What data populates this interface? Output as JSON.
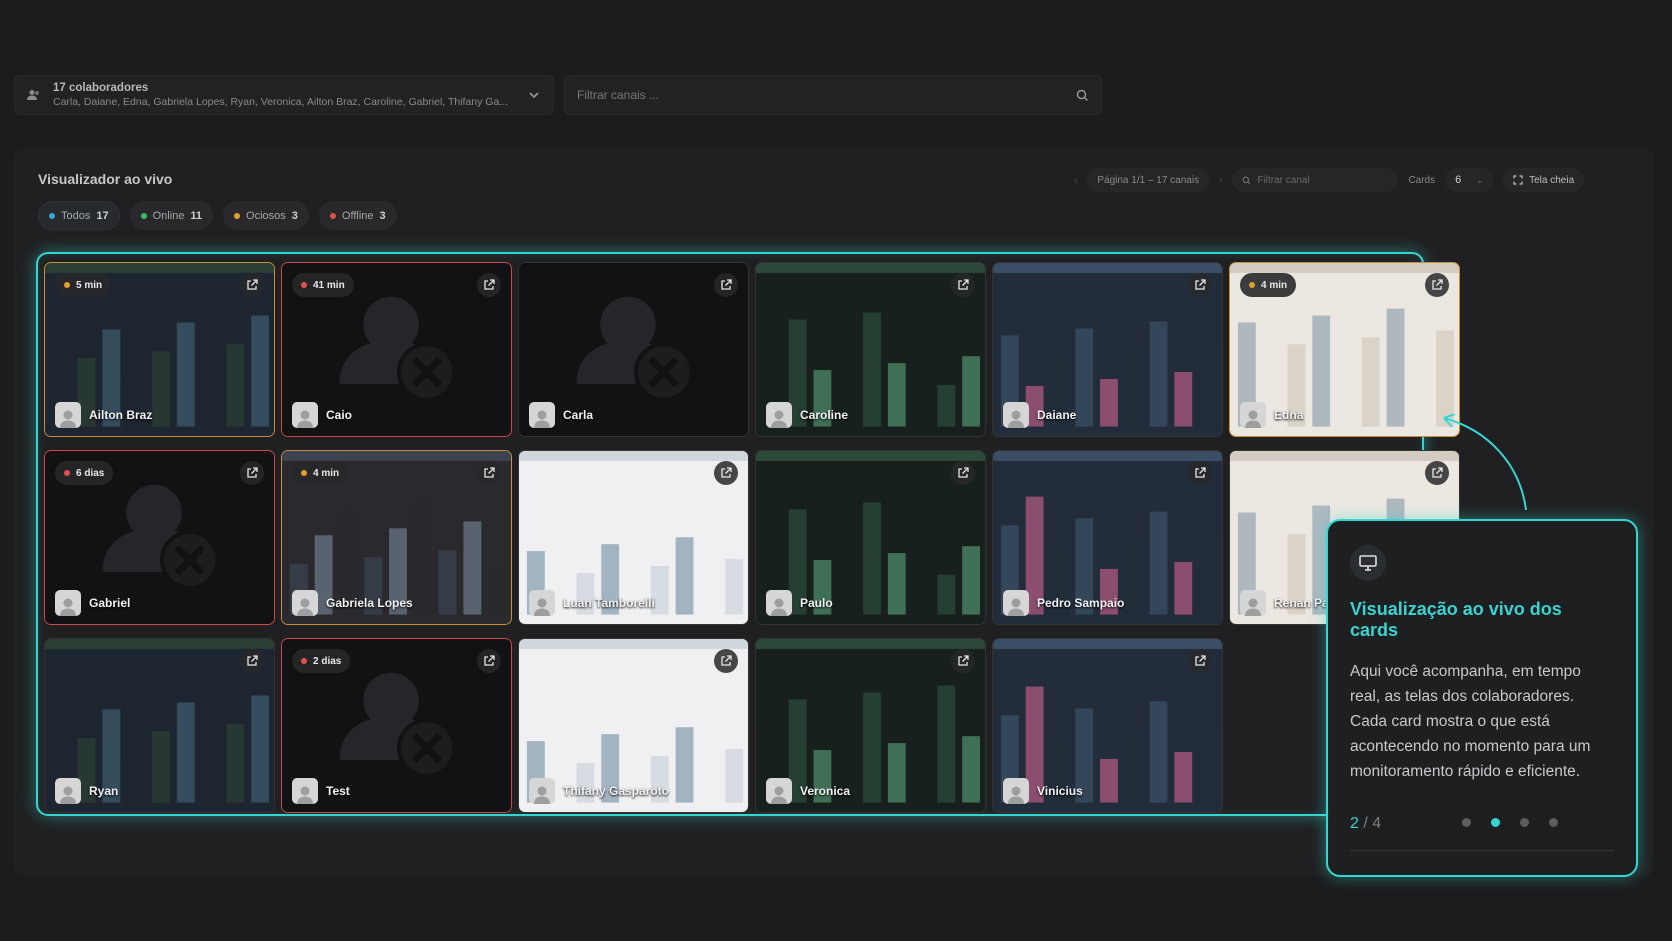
{
  "collab": {
    "title": "17 colaboradores",
    "names": "Carla, Daiane, Edna, Gabriela Lopes, Ryan, Veronica, Ailton Braz, Caroline, Gabriel, Thifany Ga..."
  },
  "search": {
    "placeholder": "Filtrar canais ..."
  },
  "panel": {
    "title": "Visualizador ao vivo",
    "filters": [
      {
        "label": "Todos",
        "count": "17",
        "color": "#3aa6d8"
      },
      {
        "label": "Online",
        "count": "11",
        "color": "#3bbf6a"
      },
      {
        "label": "Ociosos",
        "count": "3",
        "color": "#e0a030"
      },
      {
        "label": "Offline",
        "count": "3",
        "color": "#e05050"
      }
    ],
    "pager": "Página 1/1 – 17 canais",
    "filter_canal_placeholder": "Filtrar canal",
    "cards_label": "Cards",
    "cards_value": "6",
    "fullscreen": "Tela cheia"
  },
  "cards": [
    {
      "name": "Ailton Braz",
      "badge": "5 min",
      "status": "idle"
    },
    {
      "name": "Caio",
      "badge": "41 min",
      "status": "offline"
    },
    {
      "name": "Carla",
      "badge": "",
      "status": "offline-noborder"
    },
    {
      "name": "Caroline",
      "badge": "",
      "status": "online"
    },
    {
      "name": "Daiane",
      "badge": "",
      "status": "online"
    },
    {
      "name": "Edna",
      "badge": "4 min",
      "status": "idle"
    },
    {
      "name": "Gabriel",
      "badge": "6 dias",
      "status": "offline"
    },
    {
      "name": "Gabriela Lopes",
      "badge": "4 min",
      "status": "idle"
    },
    {
      "name": "Luan Tamborelli",
      "badge": "",
      "status": "online"
    },
    {
      "name": "Paulo",
      "badge": "",
      "status": "online"
    },
    {
      "name": "Pedro Sampaio",
      "badge": "",
      "status": "online"
    },
    {
      "name": "Renan Pa",
      "badge": "",
      "status": "online"
    },
    {
      "name": "Ryan",
      "badge": "",
      "status": "online"
    },
    {
      "name": "Test",
      "badge": "2 dias",
      "status": "offline"
    },
    {
      "name": "Thifany Gasparoto",
      "badge": "",
      "status": "online"
    },
    {
      "name": "Veronica",
      "badge": "",
      "status": "online"
    },
    {
      "name": "Vinicius",
      "badge": "",
      "status": "online"
    }
  ],
  "tour": {
    "icon": "monitor-icon",
    "title": "Visualização ao vivo dos cards",
    "body": "Aqui você acompanha, em tempo real, as telas dos colaboradores. Cada card mostra o que está acontecendo no momento para um monitoramento rápido e eficiente.",
    "step_current": "2",
    "step_total": "/ 4"
  },
  "colors": {
    "accent": "#36d6d0",
    "idle": "#e0a030",
    "offline": "#e05050"
  }
}
